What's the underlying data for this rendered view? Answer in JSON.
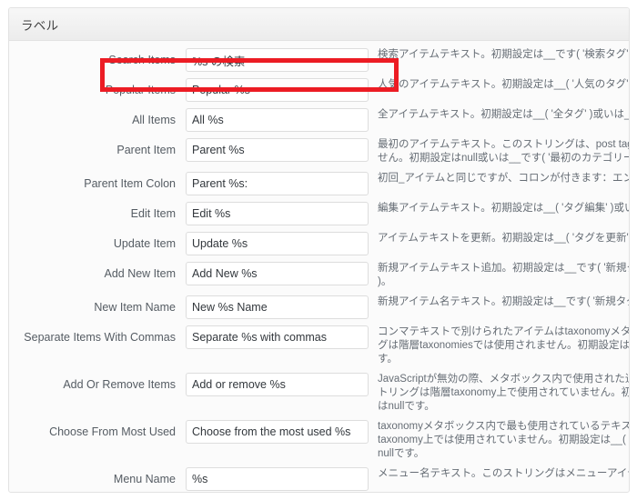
{
  "panel": {
    "title": "ラベル"
  },
  "highlight": {
    "color": "#ec1c24",
    "target_row": "Search Items"
  },
  "rows": [
    {
      "label": "Search Items",
      "value": "%s の検索",
      "desc": [
        "検索アイテムテキスト。初期設定は__です( '検索タグ' )。"
      ],
      "gap_before": 0
    },
    {
      "label": "Popular Items",
      "value": "Popular %s",
      "desc": [
        "人気のアイテムテキスト。初期設定は__( '人気のタグ' )。"
      ],
      "gap_before": 7
    },
    {
      "label": "All Items",
      "value": "All %s",
      "desc": [
        "全アイテムテキスト。初期設定は__( '全タグ' )或いは__です。"
      ],
      "gap_before": 7
    },
    {
      "label": "Parent Item",
      "value": "Parent %s",
      "desc": [
        "最初のアイテムテキスト。このストリングは、post tag(投稿タグ)では使用されま",
        "せん。初期設定はnull或いは__です( '最初のカテゴリー' )。"
      ],
      "gap_before": 7
    },
    {
      "label": "Parent Item Colon",
      "value": "Parent %s:",
      "desc": [
        "初回_アイテムと同じですが、コロンが付きます：エントリー編集画面で使用。"
      ],
      "gap_before": 7
    },
    {
      "label": "Edit Item",
      "value": "Edit %s",
      "desc": [
        "編集アイテムテキスト。初期設定は__( 'タグ編集' )或いは__です。"
      ],
      "gap_before": 7
    },
    {
      "label": "Update Item",
      "value": "Update %s",
      "desc": [
        "アイテムテキストを更新。初期設定は__( 'タグを更新' )或いは__です。"
      ],
      "gap_before": 7
    },
    {
      "label": "Add New Item",
      "value": "Add New %s",
      "desc": [
        "新規アイテムテキスト追加。初期設定は__です( '新規タグを追加' )或いは__です",
        ")。"
      ],
      "gap_before": 7
    },
    {
      "label": "New Item Name",
      "value": "New %s Name",
      "desc": [
        "新規アイテム名テキスト。初期設定は__です( '新規タグ名' )或いは__です。"
      ],
      "gap_before": 7
    },
    {
      "label": "Separate Items With Commas",
      "value": "Separate %s with commas",
      "desc": [
        "コンマテキストで別けられたアイテムはtaxonomyメタボックス内で使用。このストリン",
        "グは階層taxonomiesでは使用されません。初期設定は__( 'タグはコンマで区切りま',",
        "す。"
      ],
      "gap_before": 7
    },
    {
      "label": "Add Or Remove Items",
      "value": "Add or remove %s",
      "desc": [
        "JavaScriptが無効の際、メタボックス内で使用された追加や削除アイテム。このス",
        "トリングは階層taxonomy上で使用されていません。初期設定は__です。或い",
        "はnullです。"
      ],
      "gap_before": 7
    },
    {
      "label": "Choose From Most Used",
      "value": "Choose from the most used %s",
      "desc": [
        "taxonomyメタボックス内で最も使用されているテキストから選択。このストリングは階層",
        "taxonomy上では使用されていません。初期設定は__( '最も使用されたもの' )或いは",
        "nullです。"
      ],
      "gap_before": 7
    },
    {
      "label": "Menu Name",
      "value": "%s",
      "desc": [
        "メニュー名テキスト。このストリングはメニューアイテムのラベルとして使用されます。"
      ],
      "gap_before": 7
    }
  ]
}
